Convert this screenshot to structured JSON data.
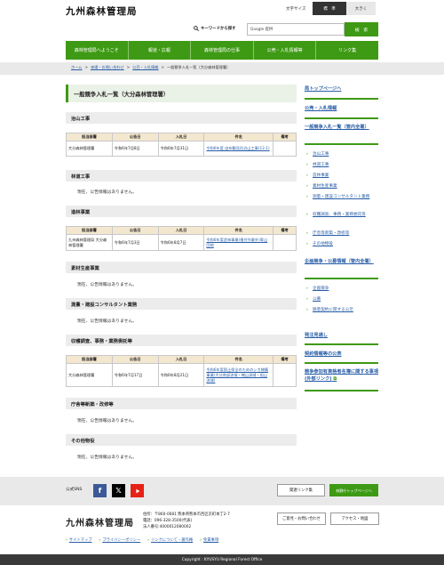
{
  "header": {
    "logo": "九州森林管理局",
    "font_size_label": "文字サイズ",
    "font_size_standard": "標　準",
    "font_size_large": "大きく",
    "search_label": "キーワードから探す",
    "search_box_text": "Google 提供",
    "search_button": "検　索"
  },
  "nav": [
    "森林管理局へようこそ",
    "報道・広報",
    "森林管理局の仕事",
    "公売・入札情報等",
    "リンク集"
  ],
  "breadcrumb": {
    "items": [
      "ホーム",
      "来場・お問い合わせ",
      "公売・入札情報"
    ],
    "current": "一般競争入札一覧（大分森林管理署）",
    "sep": ">"
  },
  "main": {
    "title": "一般競争入札一覧（大分森林管理署）",
    "table_headers": [
      "担当部署",
      "公告日",
      "入札日",
      "件名",
      "備考"
    ],
    "no_notice": "現在、公告情報はありません。",
    "sections": [
      {
        "title": "治山工事",
        "rows": [
          [
            "大分森林管理署",
            "令和6年7月8日",
            "令和6年7月31日",
            "令和6年度 由布鶴見岳治山工事(12-1)",
            ""
          ]
        ]
      },
      {
        "title": "林道工事"
      },
      {
        "title": "造林事業",
        "rows": [
          [
            "九州森林管理局 大分森林管理署",
            "令和6年7月3日",
            "令和6年8月7日",
            "令和6年度造林事業(植付作業外)青山団地",
            ""
          ]
        ]
      },
      {
        "title": "素材生産事業"
      },
      {
        "title": "測量・建設コンサルタント業務"
      },
      {
        "title": "収穫調査、事務・業務委託等",
        "rows": [
          [
            "大分森林管理署",
            "令和6年7月17日",
            "令和6年8月21日",
            "令和6年度国土保全のためのシカ捕獲事業(大分南部流域・緒山流域・祖山流域)",
            ""
          ]
        ]
      },
      {
        "title": "庁舎等新築・改修等"
      },
      {
        "title": "その他物役"
      }
    ]
  },
  "sidebar": {
    "top_page": "局トップページへ",
    "public_sale": "公売・入札情報",
    "competitive_list": "一般競争入札一覧（管内全署）",
    "list_items": [
      "治山工事",
      "林道工事",
      "造林事業",
      "素材生産事業",
      "測量・建設コンサルタント業務",
      "収穫調査、事務・業務委託等",
      "庁舎等新築・改修等",
      "その他物役"
    ],
    "planning_head": "企画競争・公募情報（管内全署）",
    "planning_items": [
      "企画競争",
      "公募",
      "随意契約に関する公示"
    ],
    "order_forecast": "発注見通し",
    "contract_info": "契約情報等の公表",
    "qualified": "競争参加有資格者名簿に関する事項(外部リンク)"
  },
  "footer": {
    "sns_label": "公式SNS",
    "related_links": "関連リンク集",
    "forest_top": "林野庁トップページへ",
    "logo": "九州森林管理局",
    "address": [
      "住所：〒860-0081 熊本県熊本市西区京町本丁2-7",
      "電話：096-328-3500(代表)",
      "法人番号:4000012080002"
    ],
    "contact_btn": "ご意見・お問い合わせ",
    "access_btn": "アクセス・地図",
    "links": [
      "サイトマップ",
      "プライバシーポリシー",
      "リンクについて・著作権",
      "免責事項"
    ],
    "copyright": "Copyright : KYUSYU Regional Forest Office",
    "colors": {
      "accent": "#3e9a14",
      "facebook": "#3b5998",
      "x": "#000000",
      "youtube": "#e62117"
    }
  }
}
